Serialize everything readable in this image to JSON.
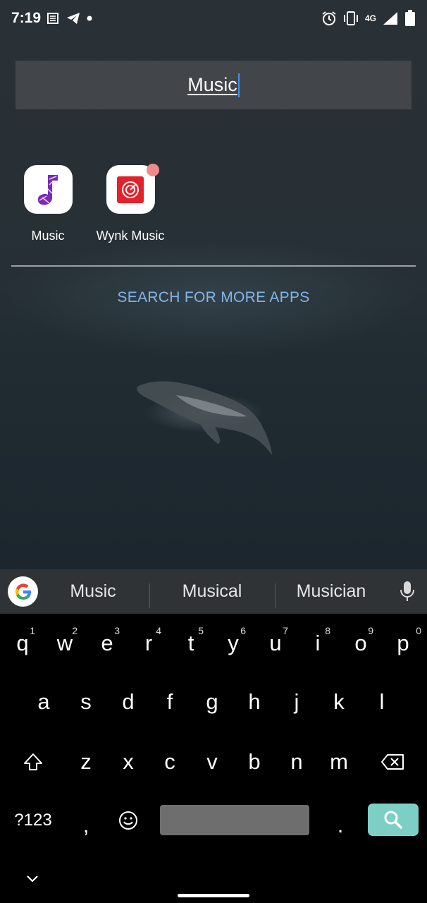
{
  "status_bar": {
    "time": "7:19",
    "network": "4G",
    "battery_level": "73"
  },
  "search": {
    "query": "Music"
  },
  "apps": [
    {
      "label": "Music",
      "icon": "music-note-icon",
      "badge": false
    },
    {
      "label": "Wynk Music",
      "icon": "wynk-music-icon",
      "badge": true
    }
  ],
  "more_apps_label": "SEARCH FOR MORE APPS",
  "suggestions": [
    "Music",
    "Musical",
    "Musician"
  ],
  "keyboard": {
    "row1": [
      {
        "key": "q",
        "hint": "1"
      },
      {
        "key": "w",
        "hint": "2"
      },
      {
        "key": "e",
        "hint": "3"
      },
      {
        "key": "r",
        "hint": "4"
      },
      {
        "key": "t",
        "hint": "5"
      },
      {
        "key": "y",
        "hint": "6"
      },
      {
        "key": "u",
        "hint": "7"
      },
      {
        "key": "i",
        "hint": "8"
      },
      {
        "key": "o",
        "hint": "9"
      },
      {
        "key": "p",
        "hint": "0"
      }
    ],
    "row2": [
      "a",
      "s",
      "d",
      "f",
      "g",
      "h",
      "j",
      "k",
      "l"
    ],
    "row3": [
      "z",
      "x",
      "c",
      "v",
      "b",
      "n",
      "m"
    ],
    "symbols_label": "?123",
    "comma": ",",
    "period": "."
  },
  "colors": {
    "accent_link": "#7fb6ea",
    "enter_key": "#7ccfc4",
    "badge": "#f08a8a",
    "cursor": "#4a90e2"
  }
}
